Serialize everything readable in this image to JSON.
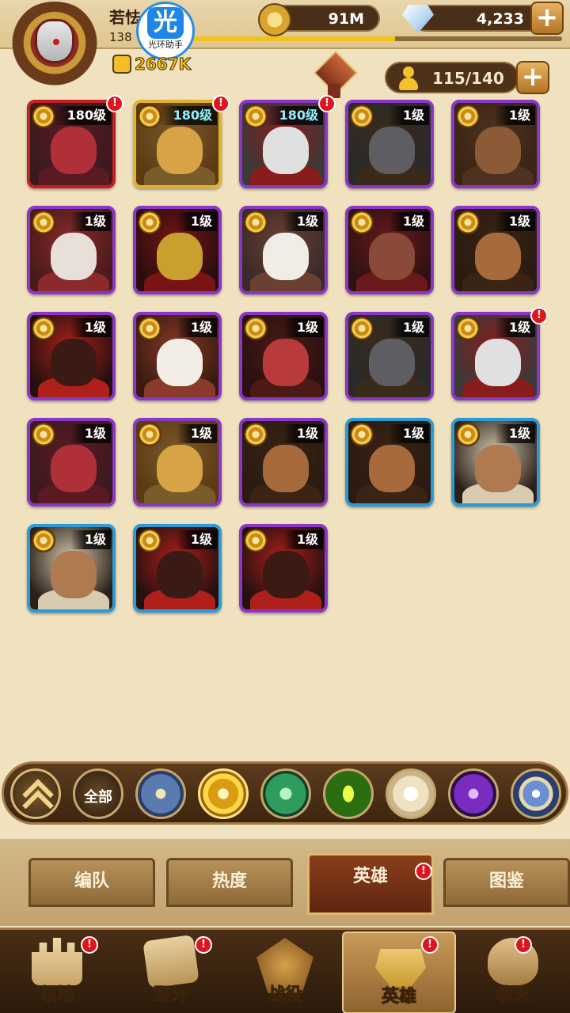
{
  "player": {
    "name": "若怯",
    "level": "138",
    "power": "2667K",
    "xp_fraction": 0.55
  },
  "overlay_badge": {
    "glyph": "光",
    "label": "光环助手"
  },
  "resources": {
    "gold": "91M",
    "gems": "4,233"
  },
  "hero_count": "115/140",
  "plus_symbol": "+",
  "heroes": [
    {
      "level": "180级",
      "frame": "red",
      "alert": true,
      "level_color": "white",
      "palette": "red-hair"
    },
    {
      "level": "180级",
      "frame": "gold",
      "alert": true,
      "level_color": "cyan",
      "palette": "lion"
    },
    {
      "level": "180级",
      "frame": "purple",
      "alert": true,
      "level_color": "cyan",
      "palette": "bird"
    },
    {
      "level": "1级",
      "frame": "purple",
      "alert": false,
      "palette": "wolf"
    },
    {
      "level": "1级",
      "frame": "purple",
      "alert": false,
      "palette": "bear"
    },
    {
      "level": "1级",
      "frame": "purple",
      "alert": false,
      "palette": "ram"
    },
    {
      "level": "1级",
      "frame": "purple",
      "alert": false,
      "palette": "mask"
    },
    {
      "level": "1级",
      "frame": "purple",
      "alert": false,
      "palette": "white-hair"
    },
    {
      "level": "1级",
      "frame": "purple",
      "alert": false,
      "palette": "beast"
    },
    {
      "level": "1级",
      "frame": "purple",
      "alert": false,
      "palette": "hound"
    },
    {
      "level": "1级",
      "frame": "purple",
      "alert": false,
      "palette": "dark-hair"
    },
    {
      "level": "1级",
      "frame": "purple",
      "alert": false,
      "palette": "skull"
    },
    {
      "level": "1级",
      "frame": "purple",
      "alert": false,
      "palette": "fox"
    },
    {
      "level": "1级",
      "frame": "purple",
      "alert": false,
      "palette": "wolf"
    },
    {
      "level": "1级",
      "frame": "purple",
      "alert": true,
      "palette": "bird"
    },
    {
      "level": "1级",
      "frame": "purple",
      "alert": false,
      "palette": "red-hair"
    },
    {
      "level": "1级",
      "frame": "purple",
      "alert": false,
      "palette": "lion"
    },
    {
      "level": "1级",
      "frame": "purple",
      "alert": false,
      "palette": "hound"
    },
    {
      "level": "1级",
      "frame": "blue",
      "alert": false,
      "palette": "hound"
    },
    {
      "level": "1级",
      "frame": "blue",
      "alert": false,
      "palette": "warrior"
    },
    {
      "level": "1级",
      "frame": "blue",
      "alert": false,
      "palette": "warrior"
    },
    {
      "level": "1级",
      "frame": "blue",
      "alert": false,
      "palette": "dark-hair"
    },
    {
      "level": "1级",
      "frame": "purple",
      "alert": false,
      "palette": "dark-hair"
    }
  ],
  "alert_symbol": "!",
  "faction_filters": [
    {
      "name": "collapse",
      "icon": "chevron-up-icon"
    },
    {
      "name": "all",
      "label": "全部"
    },
    {
      "name": "lightbearer",
      "icon": "compass-star-icon"
    },
    {
      "name": "selected",
      "icon": "sun-sigil-icon"
    },
    {
      "name": "wilder",
      "icon": "leaf-icon"
    },
    {
      "name": "graveborn",
      "icon": "eye-icon"
    },
    {
      "name": "celestial",
      "icon": "star-burst-icon"
    },
    {
      "name": "hypogean",
      "icon": "dark-crystal-icon"
    },
    {
      "name": "dimensional",
      "icon": "orb-icon"
    }
  ],
  "subtabs": [
    {
      "label": "编队",
      "active": false,
      "alert": false
    },
    {
      "label": "热度",
      "active": false,
      "alert": false
    },
    {
      "label": "英雄",
      "active": true,
      "alert": true
    },
    {
      "label": "图鉴",
      "active": false,
      "alert": false
    }
  ],
  "bottom_nav": [
    {
      "label": "领地",
      "icon": "castle-icon",
      "alert": true,
      "active": false
    },
    {
      "label": "野外",
      "icon": "map-scroll-icon",
      "alert": true,
      "active": false
    },
    {
      "label": "战役",
      "icon": "battle-shield-icon",
      "alert": false,
      "active": false
    },
    {
      "label": "英雄",
      "icon": "hero-helmet-icon",
      "alert": true,
      "active": true
    },
    {
      "label": "聊天",
      "icon": "chat-bubble-icon",
      "alert": true,
      "active": false
    }
  ]
}
